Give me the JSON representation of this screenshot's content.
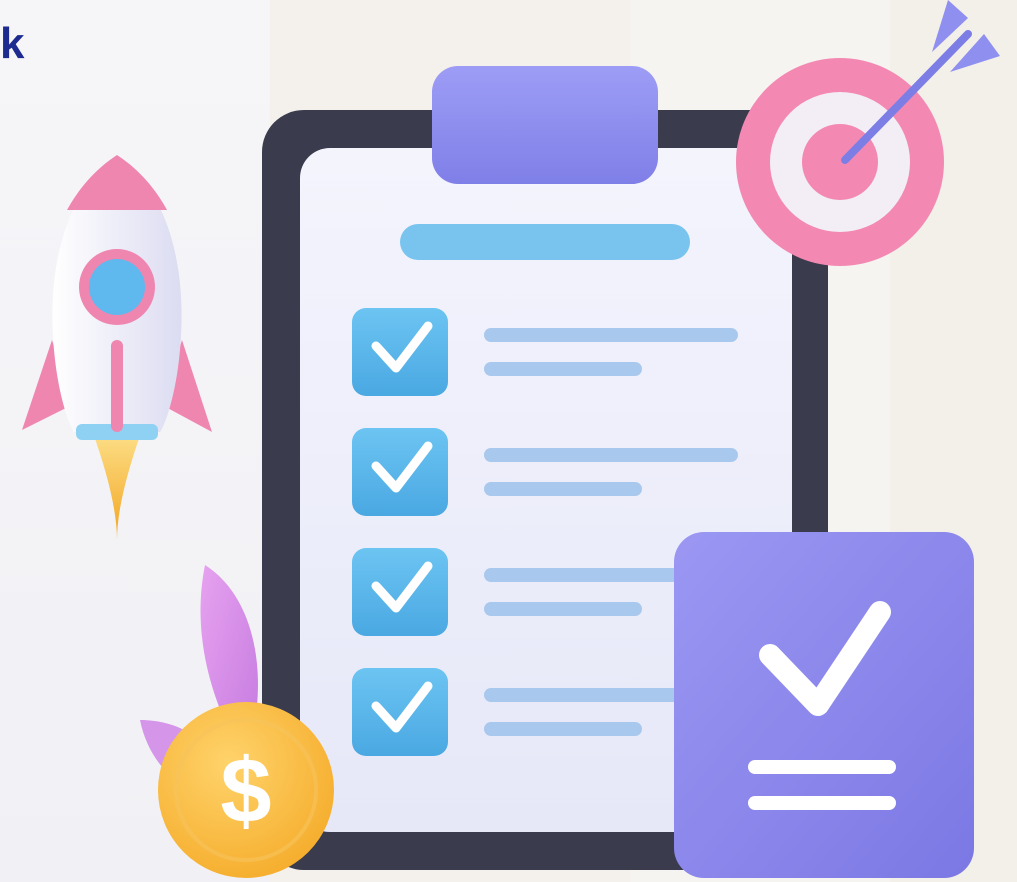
{
  "brand": {
    "visible_text": "k"
  },
  "illustration": {
    "clipboard": {
      "checklist_items": [
        {
          "checked": true
        },
        {
          "checked": true
        },
        {
          "checked": true
        },
        {
          "checked": true
        }
      ]
    },
    "coin": {
      "symbol": "$"
    },
    "icons": [
      "rocket-icon",
      "target-icon",
      "arrow-icon",
      "coin-icon",
      "leaf-icon",
      "checkmark-icon",
      "clipboard-icon"
    ]
  },
  "colors": {
    "brand_navy": "#1d2a8f",
    "clipboard_frame": "#3b3c4f",
    "clipboard_paper": "#eef0fb",
    "clip_purple": "#8e8ef0",
    "check_blue": "#5cb8ec",
    "line_blue": "#a9c8ee",
    "card_purple": "#8d88ee",
    "target_pink": "#f489b2",
    "coin_yellow": "#fbc04b",
    "rocket_pink": "#f08bb3",
    "flame_yellow": "#f7b83a"
  }
}
